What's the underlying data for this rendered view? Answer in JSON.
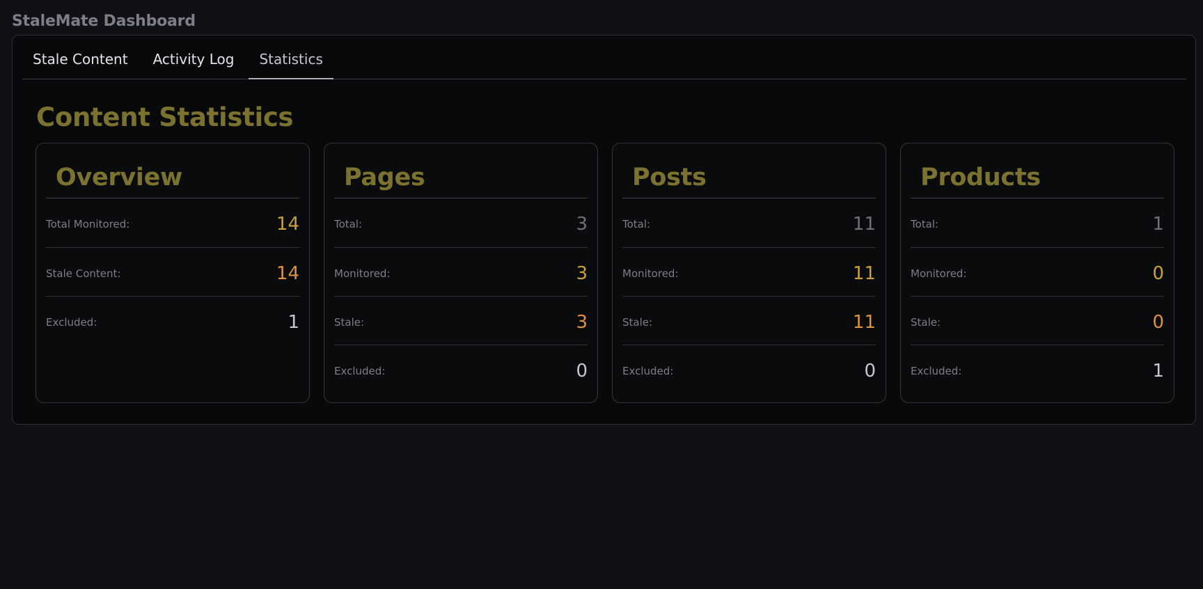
{
  "app": {
    "title": "StaleMate Dashboard"
  },
  "tabs": [
    {
      "label": "Stale Content",
      "active": false
    },
    {
      "label": "Activity Log",
      "active": false
    },
    {
      "label": "Statistics",
      "active": true
    }
  ],
  "main": {
    "title": "Content Statistics",
    "cards": [
      {
        "title": "Overview",
        "rows": [
          {
            "label": "Total Monitored:",
            "value": "14",
            "color": "#c9a03a"
          },
          {
            "label": "Stale Content:",
            "value": "14",
            "color": "#e0913b"
          },
          {
            "label": "Excluded:",
            "value": "1",
            "color": "#c5c8d4"
          }
        ]
      },
      {
        "title": "Pages",
        "rows": [
          {
            "label": "Total:",
            "value": "3",
            "color": "#6f7178"
          },
          {
            "label": "Monitored:",
            "value": "3",
            "color": "#c9a03a"
          },
          {
            "label": "Stale:",
            "value": "3",
            "color": "#e0913b"
          },
          {
            "label": "Excluded:",
            "value": "0",
            "color": "#c5c8d4"
          }
        ]
      },
      {
        "title": "Posts",
        "rows": [
          {
            "label": "Total:",
            "value": "11",
            "color": "#6f7178"
          },
          {
            "label": "Monitored:",
            "value": "11",
            "color": "#c9a03a"
          },
          {
            "label": "Stale:",
            "value": "11",
            "color": "#e0913b"
          },
          {
            "label": "Excluded:",
            "value": "0",
            "color": "#c5c8d4"
          }
        ]
      },
      {
        "title": "Products",
        "rows": [
          {
            "label": "Total:",
            "value": "1",
            "color": "#6f7178"
          },
          {
            "label": "Monitored:",
            "value": "0",
            "color": "#c9a03a"
          },
          {
            "label": "Stale:",
            "value": "0",
            "color": "#e0913b"
          },
          {
            "label": "Excluded:",
            "value": "1",
            "color": "#c5c8d4"
          }
        ]
      }
    ]
  }
}
